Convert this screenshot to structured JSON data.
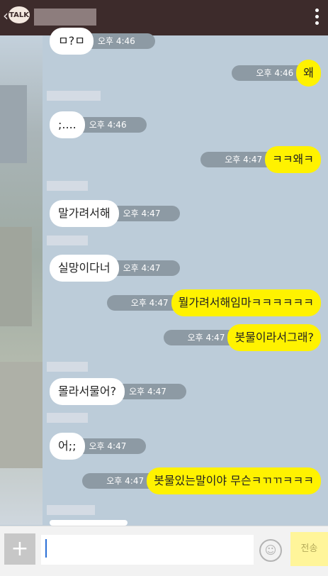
{
  "header": {
    "back_icon": "‹",
    "logo_text": "TALK",
    "menu_icon": "vertical-dots-icon"
  },
  "messages": [
    {
      "side": "left",
      "text": "ㅁ?ㅁ",
      "time": "오후 4:46"
    },
    {
      "side": "right",
      "text": "왜",
      "time": "오후 4:46"
    },
    {
      "side": "left",
      "text": ";....",
      "time": "오후 4:46"
    },
    {
      "side": "right",
      "text": "ㅋㅋ왜ㅋ",
      "time": "오후 4:47"
    },
    {
      "side": "left",
      "text": "말가려서해",
      "time": "오후 4:47"
    },
    {
      "side": "left",
      "text": "실망이다너",
      "time": "오후 4:47"
    },
    {
      "side": "right",
      "text": "뭘가려서해임마ㅋㅋㅋㅋㅋㅋ",
      "time": "오후 4:47"
    },
    {
      "side": "right",
      "text": "봇물이라서그래?",
      "time": "오후 4:47"
    },
    {
      "side": "left",
      "text": "몰라서물어?",
      "time": "오후 4:47"
    },
    {
      "side": "left",
      "text": "어;;",
      "time": "오후 4:47"
    },
    {
      "side": "right",
      "text": "봇물있는말이야 무슨ㅋㄲㄲㅋㅋㅋ",
      "time": "오후 4:47"
    }
  ],
  "composer": {
    "plus_label": "+",
    "send_label": "전송",
    "emoji_icon": "smiley-icon"
  }
}
